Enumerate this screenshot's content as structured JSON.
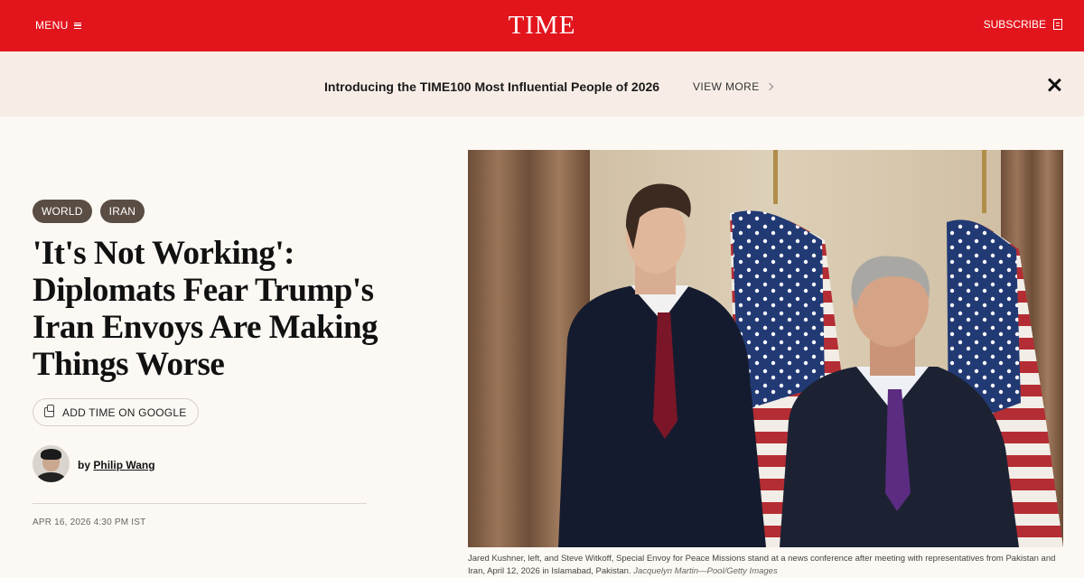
{
  "header": {
    "menu_label": "MENU",
    "logo": "TIME",
    "subscribe_label": "SUBSCRIBE",
    "brand_color": "#e2151d"
  },
  "promo": {
    "text": "Introducing the TIME100 Most Influential People of 2026",
    "link_label": "VIEW MORE",
    "close_icon": "close-icon"
  },
  "article": {
    "tags": [
      "WORLD",
      "IRAN"
    ],
    "headline": "'It's Not Working': Diplomats Fear Trump's Iran Envoys Are Making Things Worse",
    "google_button": "ADD TIME ON GOOGLE",
    "byline_prefix": "by",
    "author": "Philip Wang",
    "date": "APR 16, 2026 4:30 PM IST"
  },
  "photo": {
    "caption": "Jared Kushner, left, and Steve Witkoff, Special Envoy for Peace Missions stand at a news conference after meeting with representatives from Pakistan and Iran, April 12, 2026 in Islamabad, Pakistan.",
    "credit": "Jacquelyn Martin—Pool/Getty Images"
  }
}
